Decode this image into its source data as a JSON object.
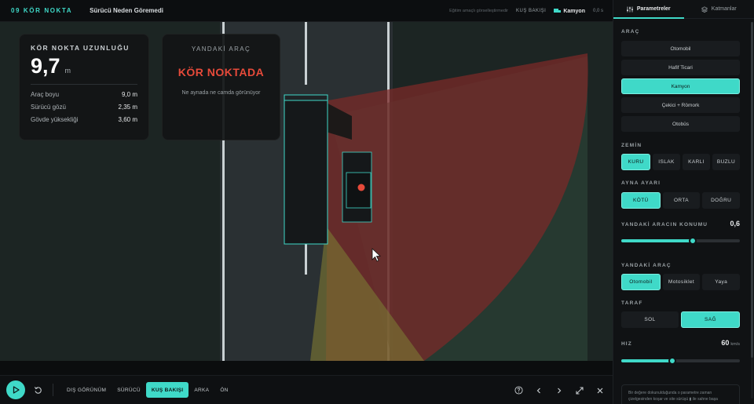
{
  "topbar": {
    "brand": "09 KÖR NOKTA",
    "subtitle": "Sürücü Neden Göremedi",
    "hint": "Eğitim amaçlı görselleştirmedir",
    "view": "KUŞ BAKIŞI",
    "vehicle": "Kamyon",
    "time": "0,0 s"
  },
  "length_card": {
    "label": "KÖR NOKTA UZUNLUĞU",
    "value": "9,7",
    "unit": "m",
    "rows": [
      {
        "label": "Araç boyu",
        "value": "9,0 m"
      },
      {
        "label": "Sürücü gözü",
        "value": "2,35 m"
      },
      {
        "label": "Gövde yüksekliği",
        "value": "3,60 m"
      }
    ]
  },
  "side_card": {
    "label": "YANDAKİ ARAÇ",
    "status": "KÖR NOKTADA",
    "desc": "Ne aynada ne camda görünüyor"
  },
  "bottombar": {
    "views": [
      "DIŞ GÖRÜNÜM",
      "SÜRÜCÜ",
      "KUŞ BAKIŞI",
      "ARKA",
      "ÖN"
    ],
    "active_view": "KUŞ BAKIŞI"
  },
  "panel": {
    "tabs": [
      "Parametreler",
      "Katmanlar"
    ],
    "vehicle_title": "ARAÇ",
    "vehicles": [
      "Otomobil",
      "Hafif Ticari",
      "Kamyon",
      "Çekici + Römork",
      "Otobüs"
    ],
    "ground_title": "ZEMİN",
    "grounds": [
      "KURU",
      "ISLAK",
      "KARLI",
      "BUZLU"
    ],
    "mirror_title": "AYNA AYARI",
    "mirrors": [
      "KÖTÜ",
      "ORTA",
      "DOĞRU"
    ],
    "position_title": "YANDAKİ ARACIN KONUMU",
    "position_value": "0,6",
    "position_fraction": 0.6,
    "side_title": "YANDAKİ ARAÇ",
    "sides": [
      "Otomobil",
      "Motosiklet",
      "Yaya"
    ],
    "direction_title": "TARAF",
    "directions": [
      "SOL",
      "SAĞ"
    ],
    "speed_title": "HIZ",
    "speed_value": "60",
    "speed_unit": "km/s",
    "speed_fraction": 0.43,
    "note": "Bir değere dokunulduğunda o parametre zaman çizelgesinden koşar ve site sürüşü ▮ ile sahne başa"
  },
  "colors": {
    "accent": "#3fd9c8",
    "danger": "#e64a3a"
  }
}
